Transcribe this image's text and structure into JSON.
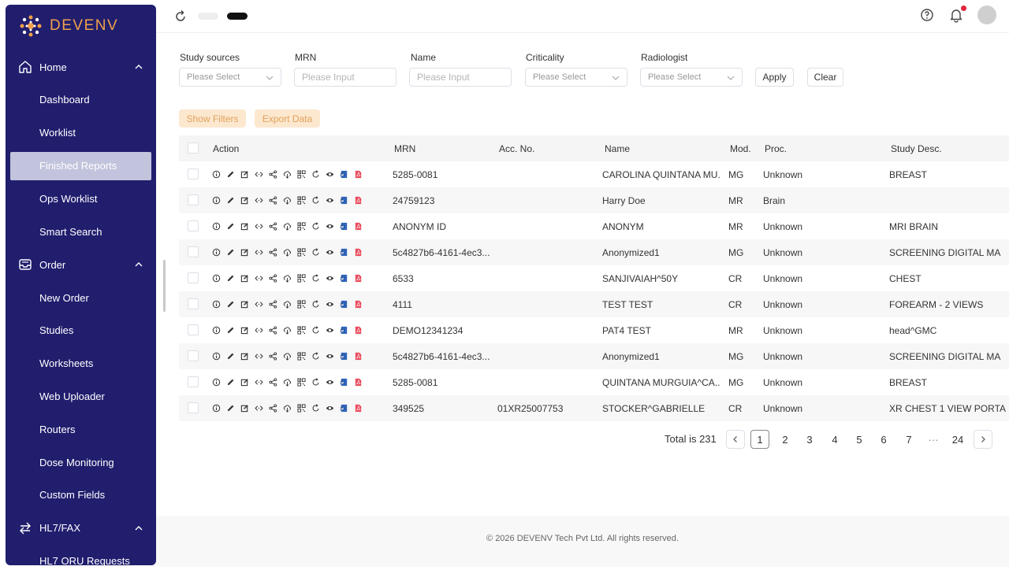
{
  "brand": {
    "name": "DEVENV",
    "color": "#f0a04b"
  },
  "sidebar": {
    "groups": [
      {
        "label": "Home",
        "icon": "home-icon"
      },
      {
        "label": "Order",
        "icon": "inbox-icon"
      },
      {
        "label": "HL7/FAX",
        "icon": "swap-icon"
      }
    ],
    "home_items": [
      "Dashboard",
      "Worklist",
      "Finished Reports",
      "Ops Worklist",
      "Smart Search"
    ],
    "order_items": [
      "New Order",
      "Studies",
      "Worksheets",
      "Web Uploader",
      "Routers",
      "Dose Monitoring",
      "Custom Fields"
    ],
    "hl7_items": [
      "HL7 ORU Requests"
    ],
    "active": "Finished Reports"
  },
  "filters": {
    "study_sources": {
      "label": "Study sources",
      "placeholder": "Please Select"
    },
    "mrn": {
      "label": "MRN",
      "placeholder": "Please Input"
    },
    "name": {
      "label": "Name",
      "placeholder": "Please Input"
    },
    "criticality": {
      "label": "Criticality",
      "placeholder": "Please Select"
    },
    "radiologist": {
      "label": "Radiologist",
      "placeholder": "Please Select"
    },
    "apply": "Apply",
    "clear": "Clear"
  },
  "toolbar": {
    "show_filters": "Show Filters",
    "export_data": "Export Data"
  },
  "table": {
    "headers": {
      "action": "Action",
      "mrn": "MRN",
      "acc": "Acc. No.",
      "name": "Name",
      "mod": "Mod.",
      "proc": "Proc.",
      "desc": "Study Desc."
    },
    "rows": [
      {
        "mrn": "5285-0081",
        "acc": "",
        "name": "CAROLINA QUINTANA MU...",
        "mod": "MG",
        "proc": "Unknown",
        "desc": "BREAST"
      },
      {
        "mrn": "24759123",
        "acc": "",
        "name": "Harry Doe",
        "mod": "MR",
        "proc": "Brain",
        "desc": ""
      },
      {
        "mrn": "ANONYM ID",
        "acc": "",
        "name": "ANONYM",
        "mod": "MR",
        "proc": "Unknown",
        "desc": "MRI BRAIN"
      },
      {
        "mrn": "5c4827b6-4161-4ec3...",
        "acc": "",
        "name": "Anonymized1",
        "mod": "MG",
        "proc": "Unknown",
        "desc": "SCREENING DIGITAL MA"
      },
      {
        "mrn": "6533",
        "acc": "",
        "name": "SANJIVAIAH^50Y",
        "mod": "CR",
        "proc": "Unknown",
        "desc": "CHEST"
      },
      {
        "mrn": "4111",
        "acc": "",
        "name": "TEST TEST",
        "mod": "CR",
        "proc": "Unknown",
        "desc": "FOREARM - 2 VIEWS"
      },
      {
        "mrn": "DEMO12341234",
        "acc": "",
        "name": "PAT4 TEST",
        "mod": "MR",
        "proc": "Unknown",
        "desc": "head^GMC"
      },
      {
        "mrn": "5c4827b6-4161-4ec3...",
        "acc": "",
        "name": "Anonymized1",
        "mod": "MG",
        "proc": "Unknown",
        "desc": "SCREENING DIGITAL MA"
      },
      {
        "mrn": "5285-0081",
        "acc": "",
        "name": "QUINTANA MURGUIA^CA...",
        "mod": "MG",
        "proc": "Unknown",
        "desc": "BREAST"
      },
      {
        "mrn": "349525",
        "acc": "01XR25007753",
        "name": "STOCKER^GABRIELLE",
        "mod": "CR",
        "proc": "Unknown",
        "desc": "XR CHEST 1 VIEW PORTA"
      }
    ],
    "action_icons": [
      "info-icon",
      "edit-icon",
      "edit-note-icon",
      "code-icon",
      "share-icon",
      "cloud-download-icon",
      "qr-icon",
      "refresh-icon",
      "view-icon",
      "word-doc-icon",
      "pdf-icon"
    ]
  },
  "pagination": {
    "total": "Total is 231",
    "pages": [
      "1",
      "2",
      "3",
      "4",
      "5",
      "6",
      "7",
      "···",
      "24"
    ],
    "current": "1"
  },
  "footer": {
    "text": "© 2026 DEVENV Tech Pvt Ltd. All rights reserved."
  }
}
